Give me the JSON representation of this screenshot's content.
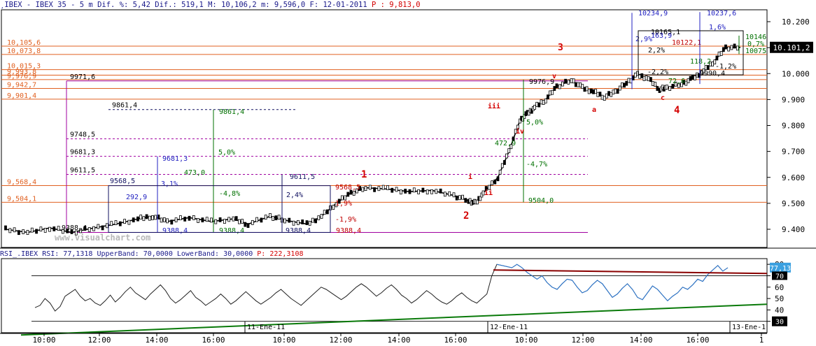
{
  "header": {
    "prefix": "¸IBEX - IBEX 35 -  5 m Dif. %: 5,42 Dif.: 519,1 M: 10,106,2 m: 9,596,0 F: 12-01-2011",
    "pending": "P : 9,813,0"
  },
  "watermark": "www.visualchart.com",
  "rsi_header": {
    "text": "RSI_.IBEX RSI: 77,1318 UpperBand: 70,0000 LowerBand: 30,0000",
    "pending": "P: 222,3108"
  },
  "colors": {
    "price": "#000000",
    "orange_level": "#e06020",
    "magenta_level": "#a000a0",
    "blue_proj": "#2020c0",
    "green_proj": "#007000",
    "red_proj": "#c00000",
    "wave_label": "#d40000",
    "rsi_line": "#202020",
    "rsi_upper_trend": "#8a0000",
    "rsi_lower_trend": "#0a7a0a",
    "last_price_bg": "#000000",
    "rsi_last_bg": "#3aa0e0"
  },
  "chart_data": [
    {
      "type": "candlestick",
      "title": "IBEX 35 - 5 m",
      "y_ticks": [
        "10.200",
        "10.100",
        "10.000",
        "9.900",
        "9.800",
        "9.700",
        "9.600",
        "9.500",
        "9.400"
      ],
      "ylim": [
        9360,
        10235
      ],
      "x_ticks": [
        "10:00",
        "12:00",
        "14:00",
        "16:00",
        "10:00",
        "12:00",
        "14:00",
        "16:00",
        "10:00",
        "12:00",
        "14:00",
        "16:00",
        "1"
      ],
      "date_markers": [
        "11-Ene-11",
        "12-Ene-11",
        "13-Ene-1"
      ],
      "last_price": "10.101,2",
      "price_path": [
        [
          0,
          9400
        ],
        [
          0.03,
          9388
        ],
        [
          0.06,
          9405
        ],
        [
          0.09,
          9388
        ],
        [
          0.12,
          9405
        ],
        [
          0.15,
          9420
        ],
        [
          0.18,
          9440
        ],
        [
          0.2,
          9450
        ],
        [
          0.22,
          9430
        ],
        [
          0.25,
          9445
        ],
        [
          0.28,
          9430
        ],
        [
          0.31,
          9440
        ],
        [
          0.33,
          9420
        ],
        [
          0.36,
          9450
        ],
        [
          0.38,
          9435
        ],
        [
          0.41,
          9420
        ],
        [
          0.43,
          9450
        ],
        [
          0.45,
          9500
        ],
        [
          0.47,
          9540
        ],
        [
          0.49,
          9560
        ],
        [
          0.52,
          9555
        ],
        [
          0.55,
          9545
        ],
        [
          0.58,
          9550
        ],
        [
          0.61,
          9530
        ],
        [
          0.63,
          9510
        ],
        [
          0.64,
          9500
        ],
        [
          0.65,
          9540
        ],
        [
          0.67,
          9600
        ],
        [
          0.685,
          9700
        ],
        [
          0.7,
          9820
        ],
        [
          0.71,
          9845
        ],
        [
          0.72,
          9870
        ],
        [
          0.735,
          9900
        ],
        [
          0.75,
          9950
        ],
        [
          0.77,
          9975
        ],
        [
          0.785,
          9945
        ],
        [
          0.8,
          9930
        ],
        [
          0.815,
          9910
        ],
        [
          0.83,
          9930
        ],
        [
          0.845,
          9965
        ],
        [
          0.86,
          9995
        ],
        [
          0.875,
          9980
        ],
        [
          0.89,
          9940
        ],
        [
          0.9,
          9945
        ],
        [
          0.92,
          9960
        ],
        [
          0.935,
          9980
        ],
        [
          0.95,
          10010
        ],
        [
          0.965,
          10050
        ],
        [
          0.98,
          10100
        ],
        [
          1,
          10101
        ]
      ],
      "horizontal_levels": [
        {
          "label": "10,105,6",
          "value": 10105.6,
          "group": "orange"
        },
        {
          "label": "10,073,8",
          "value": 10073.8,
          "group": "orange"
        },
        {
          "label": "10,015,3",
          "value": 10015.3,
          "group": "orange"
        },
        {
          "label": "9,993,8",
          "value": 9993.8,
          "group": "orange"
        },
        {
          "label": "9,976,9",
          "value": 9976.9,
          "group": "orange"
        },
        {
          "label": "9,942,7",
          "value": 9942.7,
          "group": "orange"
        },
        {
          "label": "9,901,4",
          "value": 9901.4,
          "group": "orange"
        },
        {
          "label": "9,568,4",
          "value": 9568.4,
          "group": "orange"
        },
        {
          "label": "9,504,1",
          "value": 9504.1,
          "group": "orange"
        },
        {
          "label": "9971,6",
          "value": 9971.6,
          "group": "magenta"
        },
        {
          "label": "9861,4",
          "value": 9861.4,
          "group": "navy"
        },
        {
          "label": "9748,5",
          "value": 9748.5,
          "group": "magenta"
        },
        {
          "label": "9681,3",
          "value": 9681.3,
          "group": "magenta"
        },
        {
          "label": "9611,5",
          "value": 9611.5,
          "group": "magenta"
        }
      ],
      "annotations": [
        {
          "text": "9568,5",
          "color": "navy"
        },
        {
          "text": "292,9",
          "color": "blue"
        },
        {
          "text": "3,1%",
          "color": "blue"
        },
        {
          "text": "9681,3",
          "color": "blue"
        },
        {
          "text": "9388,4",
          "color": "blue"
        },
        {
          "text": "9861,4",
          "color": "green"
        },
        {
          "text": "5,0%",
          "color": "green"
        },
        {
          "text": "473,0",
          "color": "green"
        },
        {
          "text": "-4,8%",
          "color": "green"
        },
        {
          "text": "9388,4",
          "color": "green"
        },
        {
          "text": "9611,5",
          "color": "navy"
        },
        {
          "text": "2,4%",
          "color": "navy"
        },
        {
          "text": "9388,4",
          "color": "navy"
        },
        {
          "text": "9568,5",
          "color": "red"
        },
        {
          "text": "1,9%",
          "color": "red"
        },
        {
          "text": "-1,9%",
          "color": "red"
        },
        {
          "text": "9388,4",
          "color": "red"
        },
        {
          "text": "9388,4",
          "color": "black"
        },
        {
          "text": "9976,9",
          "color": "black"
        },
        {
          "text": "472,9",
          "color": "green"
        },
        {
          "text": "5,0%",
          "color": "green"
        },
        {
          "text": "-4,7%",
          "color": "green"
        },
        {
          "text": "9504,0",
          "color": "green"
        },
        {
          "text": "10234,9",
          "color": "blue"
        },
        {
          "text": "10237,6",
          "color": "blue"
        },
        {
          "text": "1,6%",
          "color": "blue"
        },
        {
          "text": "10146",
          "color": "green"
        },
        {
          "text": "0,7%",
          "color": "green"
        },
        {
          "text": "10075",
          "color": "green"
        },
        {
          "text": "10165,1",
          "color": "black"
        },
        {
          "text": "163,9",
          "color": "blue"
        },
        {
          "text": "2,9%",
          "color": "blue"
        },
        {
          "text": "2,2%",
          "color": "black"
        },
        {
          "text": "-2,2%",
          "color": "black"
        },
        {
          "text": "-1,2%",
          "color": "black"
        },
        {
          "text": "10122,1",
          "color": "red"
        },
        {
          "text": "9990,4",
          "color": "black"
        },
        {
          "text": "118,2",
          "color": "green"
        },
        {
          "text": "72,6",
          "color": "green"
        }
      ],
      "wave_labels": [
        "1",
        "2",
        "3",
        "4",
        "i",
        "ii",
        "iii",
        "iv",
        "v",
        "a",
        "c"
      ]
    },
    {
      "type": "line",
      "title": "RSI_.IBEX RSI",
      "y_ticks": [
        "80",
        "70",
        "60",
        "50",
        "40",
        "30"
      ],
      "ylim": [
        20,
        85
      ],
      "upper_band": 70,
      "lower_band": 30,
      "last_value": "77,13",
      "upper_label": "70",
      "lower_label": "30",
      "values": [
        42,
        44,
        50,
        46,
        39,
        43,
        52,
        55,
        58,
        52,
        48,
        50,
        46,
        44,
        48,
        53,
        47,
        51,
        56,
        60,
        55,
        52,
        49,
        54,
        58,
        62,
        57,
        50,
        46,
        49,
        53,
        57,
        51,
        48,
        44,
        47,
        50,
        54,
        50,
        45,
        48,
        52,
        56,
        52,
        48,
        45,
        48,
        51,
        55,
        58,
        54,
        50,
        47,
        44,
        48,
        52,
        56,
        60,
        58,
        55,
        52,
        49,
        52,
        56,
        60,
        63,
        60,
        56,
        52,
        55,
        59,
        62,
        58,
        53,
        50,
        46,
        49,
        53,
        57,
        54,
        50,
        47,
        45,
        48,
        52,
        55,
        51,
        48,
        46,
        50,
        54,
        70,
        80,
        79,
        78,
        77,
        80,
        77,
        73,
        70,
        67,
        70,
        64,
        60,
        58,
        63,
        67,
        66,
        60,
        55,
        57,
        62,
        66,
        63,
        57,
        51,
        54,
        59,
        63,
        58,
        51,
        49,
        55,
        61,
        58,
        53,
        48,
        52,
        55,
        60,
        58,
        62,
        67,
        65,
        71,
        75,
        79,
        74,
        77
      ],
      "trendlines": [
        {
          "name": "upper",
          "from": 75,
          "to": 72
        },
        {
          "name": "lower",
          "from": 18,
          "to": 45
        }
      ]
    }
  ]
}
